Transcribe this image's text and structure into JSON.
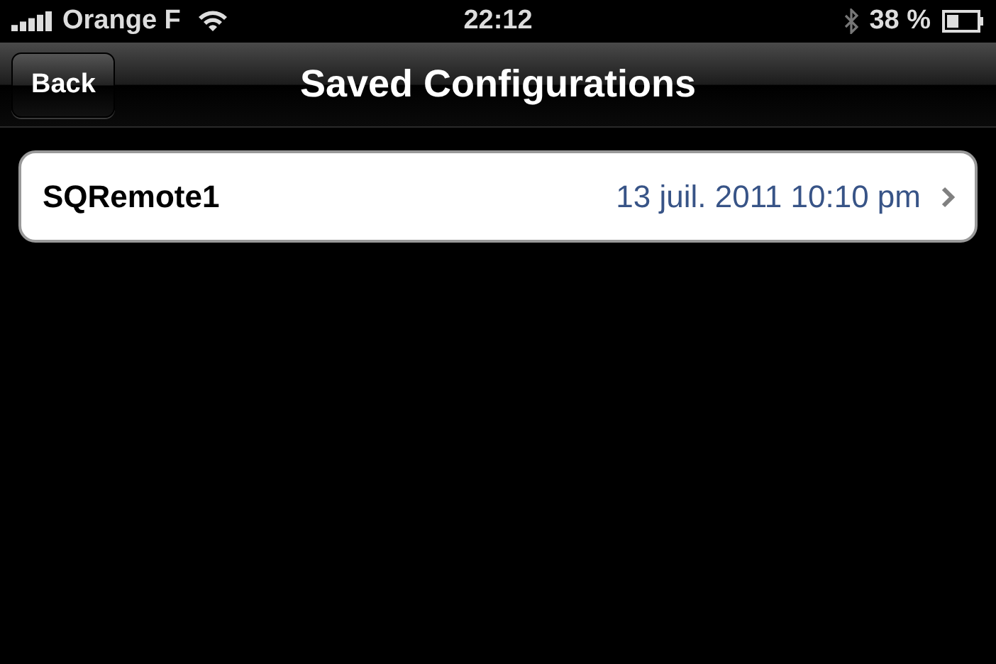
{
  "status_bar": {
    "carrier": "Orange F",
    "time": "22:12",
    "battery": "38 %"
  },
  "nav_bar": {
    "back": "Back",
    "title": "Saved Configurations"
  },
  "configurations": [
    {
      "name": "SQRemote1",
      "date": "13 juil. 2011 10:10 pm"
    }
  ]
}
